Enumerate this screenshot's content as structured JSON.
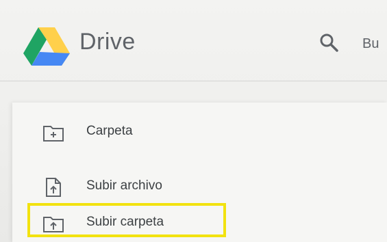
{
  "header": {
    "app_name": "Drive",
    "search_label_partial": "Bu"
  },
  "new_menu": {
    "items": [
      {
        "label": "Carpeta",
        "icon": "new-folder-icon"
      },
      {
        "label": "Subir archivo",
        "icon": "file-upload-icon"
      },
      {
        "label": "Subir carpeta",
        "icon": "folder-upload-icon",
        "highlighted": true
      }
    ]
  },
  "colors": {
    "drive_green": "#1fa463",
    "drive_yellow": "#ffd04b",
    "drive_blue": "#4688f4",
    "highlight_yellow": "#f2e20f",
    "text_gray": "#5f6368"
  }
}
